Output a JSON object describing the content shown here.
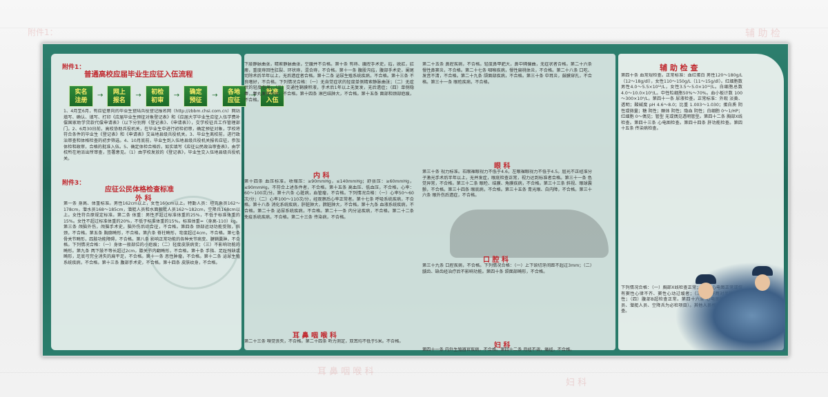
{
  "ghost": {
    "annex1": "附件1：",
    "aux": "辅 助 检",
    "surgery": "外 科",
    "ent": "耳 鼻 咽 喉 科",
    "gyn": "妇 科"
  },
  "left": {
    "annex1_label": "附件1：",
    "title": "普通高校应届毕业生应征入伍流程",
    "flow": [
      "实名\n注册",
      "网上\n报名",
      "初检\n初审",
      "确定\n预征",
      "各地\n应征",
      "批准\n入伍"
    ],
    "flow_arrow": "→",
    "intro_text": "1、4月至6月，有应征意向的毕业生登陆兵役登记报名网（http://zbbm.chsi.com.cn）网站填写、确认、填写、打印《应届毕业生预征对象登记表》和《应届大学毕业生应征入伍学费补偿国家助学贷款代偿申请表》（以下分别称《登记表》、《申请表》），交学校征兵工作管理部门。2、6月30日前，高校协助兵役机关，在毕业生中进行初检初审，确定预征对象，学校将符合条件的毕业生《登记表》和《申请表》交当地县级兵役机关。3、毕业生离校前，进行政治审查和体格检查的初步筛选。4、10月底前，毕业生到入伍地县级兵役机关报名应征，参加体检和政审，合格的批准入伍。5、确定体检合格后，如实填写《应征公民政治审查表》，由学校所在地派出所审查，签署意见。（1）由学校发放的《登记表》，毕业生交入伍地县级兵役机关。",
    "annex3_label": "附件3：",
    "standard_title": "应征公民体格检查标准",
    "surgery_label": "外 科",
    "surgery_text": "第一条 身高、体重标准。男性162cm以上，女性160cm以上。特勤人员：坦克乘员162～178cm，潜水员168～185cm，潜艇人员和水面舰艇人员162～182cm，空降兵168cm以上。女性符合原规定标准。第二条 体重：男性不超过标准体重的25%，不低于标准体重的15%。女性不超过标准体重的20%，不低于标准体重的15%。标准体重=（身高-110）kg。第三条 颅脑外伤，颅脑手术史，脑外伤后综合征，不合格。第四条 颈部运动功能受限，斜颈，不合格。第五条 胸廓畸形，不合格。第六条 脊柱畸形，弯度超过4cm，不合格。第七条 骨关节畸形，四肢功能障碍，不合格。第八条 影响正常功能的各种关节病变、腱鞘囊肿，不合格。下列情况合格：（一）身体一般部位的小疤痕；（二）轻度皮肤病变；（三）不影响功能的畸形。第九条 两下肢不等长超过2cm，膝关节内翻畸形，不合格。第十条 手指、足趾残缺或畸形，足底弓完全消失的扁平足，不合格。第十一条 恶性肿瘤，不合格。第十二条 泌尿生殖系统疾病，不合格。第十三条 腹部手术史，不合格。第十四条 皮肤纹身，不合格。"
  },
  "middle": {
    "col1_text": "下肢静脉曲张，精索静脉曲张，空腹并不合格。第十条 有痔、腹腔手术史，疝，脱肛，肛瘘，重度痔回性肛裂、环状痔，混合痔，不合格。第十一条 腹股沟疝，腹部手术史，阑尾切除术后半年以上，无后遗症者合格。第十二条 泌尿生殖系统疾病，不合格。第十三条 不良嗜好，不合格。下列情况合格：（一）无自觉症状的轻度单侧精索静脉曲张；（二）无症状的轻度包茎；（三）交通性鞘膜积液，手术后1年以上无复发，无后遗症；（四）单侧隐睾，睾丸发育不良，不合格。第十四条 淋巴结肿大，不合格。第十五条 面部和颈部疤痕，不合格。",
    "internal_label": "内 科",
    "col1b_text": "第十四条 血压标准。收缩压：≥90mmHg，≤140mmHg；舒张压：≥60mmHg，≤90mmHg。不符合上述条件者，不合格。第十五条 高血压、低血压，不合格。心率：60～100次/分。第十六条 心脏病，血管瘤，不合格。下列情况合格：（一）心率50～60次/分；（二）心率100～110次/分，经观察后心率正常者。第十七条 呼吸系统疾病，不合格。第十八条 消化系统疾病，肝脏肿大，脾脏肿大，不合格。第十九条 血液系统疾病，不合格。第二十条 泌尿系统疾病，不合格。第二十一条 内分泌疾病，不合格。第二十二条 免疫系统疾病，不合格。第二十三条 传染病，不合格。",
    "ent_label": "耳 鼻 咽 喉 科",
    "col1c_text": "第二十三条 嗅觉丧失，不合格。第二十四条 听力测定，双耳均不低于5米。不合格。",
    "col2_text": "第二十五条 鼻腔疾病，不合格。轻度鼻甲肥大，鼻中隔偏曲，无症状者合格。第二十六条 慢性鼻窦炎，不合格。第二十七条 咽喉疾病，慢性扁桃体炎，不合格。第二十八条 口吃、发音不清，不合格。第二十九条 颌面部疾病，不合格。第三十条 中耳炎，鼓膜穿孔，不合格。第三十一条 眼睑疾病，不合格。",
    "eye_label": "眼 科",
    "col2b_text": "第三十条 视力标准。右眼裸眼视力不低于4.6，左眼裸眼视力不低于4.5。屈光不正经准分子激光手术后半年以上，无并发症，眼底检查正常，视力达到标准者合格。第三十一条 色觉异常，不合格。第三十二条 眼睑、结膜、角膜疾病，不合格。第三十三条 斜视、眼球震颤，不合格。第三十四条 眼底病，不合格。第三十五条 青光眼、白内障，不合格。第三十六条 眼外伤后遗症，不合格。",
    "oral_label": "口 腔 科",
    "col2c_text": "第三十九条 口腔疾病，不合格。下列情况合格：（一）上下颌切牙间距不超过3mm；（二）龋齿、缺齿经治疗后不影响功能。第四十条 颌面部畸形，不合格。",
    "gyn_label": "妇 科",
    "col2d_text": "第四十一条 内外生殖器官疾病，不合格。第四十二条 月经不调，痛经，不合格。"
  },
  "right": {
    "aux_title": "辅 助 检 查",
    "aux_text": "第四十条 血常规检查。正常标准：血红蛋白 男性120～180g/L（12～18g/dl），女性110～150g/L（11～15g/dl）。红细胞数 男性4.0～5.5×10¹²/L，女性3.5～5.0×10¹²/L。白细胞总数 4.0～10.0×10⁹/L。中性粒细胞50%～70%。血小板计数 100～300×10⁹/L。第四十一条 尿液检查。正常标准：外观 淡黄、透明；酸碱度 pH 4.6～8.0；比重 1.003～1.030；蛋白质 阴性或微量；糖 阴性；酮体 阴性；隐血 阴性；白细胞 0～1/HP；红细胞 0～偶见；管型 无或偶见透明管型。第四十二条 胸部X线检查。第四十三条 心电图检查。第四十四条 肝功能检查。第四十五条 传染病检查。",
    "aux_text2": "下列情况合格：（一）胸部X线检查正常；（二）心电图正常或仅有窦性心律不齐、窦性心动过缓者；（三）乙肝两对半检查阴性；（四）腹部B超检查正常。第四十六条 心电图检查（潜水员、潜艇人员、空降兵为必检项目）。其他人员根据需要进行检查。"
  }
}
